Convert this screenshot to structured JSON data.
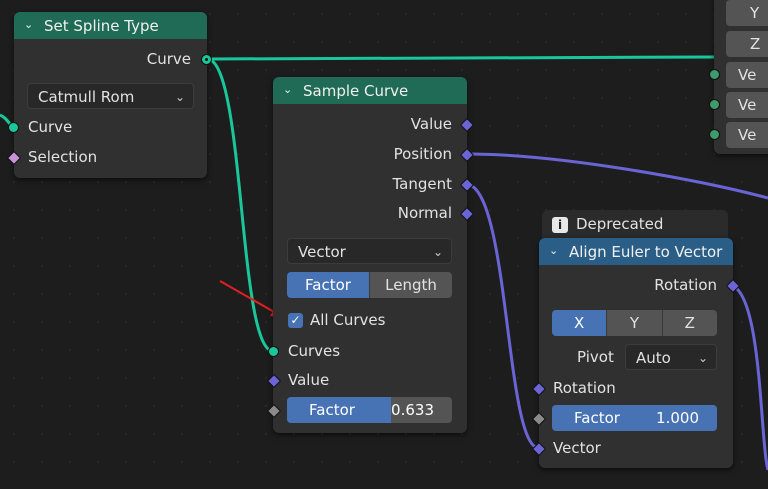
{
  "colors": {
    "wire_green": "#1ac79a",
    "wire_purple": "#6a64d4",
    "header_green": "#1f6b55",
    "header_blue": "#2a5e86",
    "accent": "#4772b3",
    "annotation_arrow": "#e02020"
  },
  "set_spline": {
    "title": "Set Spline Type",
    "output_curve": "Curve",
    "spline_type": "Catmull Rom",
    "input_curve": "Curve",
    "input_selection": "Selection"
  },
  "sample_curve": {
    "title": "Sample Curve",
    "outputs": {
      "value": "Value",
      "position": "Position",
      "tangent": "Tangent",
      "normal": "Normal"
    },
    "data_type": "Vector",
    "mode_factor": "Factor",
    "mode_length": "Length",
    "all_curves": "All Curves",
    "input_curves": "Curves",
    "input_value": "Value",
    "factor_label": "Factor",
    "factor_value": "0.633",
    "factor_fraction": 0.633
  },
  "align_euler": {
    "deprecated": "Deprecated",
    "title": "Align Euler to Vector",
    "output_rotation": "Rotation",
    "axis": [
      "X",
      "Y",
      "Z"
    ],
    "pivot_label": "Pivot",
    "pivot_value": "Auto",
    "input_rotation": "Rotation",
    "factor_label": "Factor",
    "factor_value": "1.000",
    "input_vector": "Vector"
  },
  "top_right_node": {
    "axis_y": "Y",
    "axis_z": "Z",
    "vec_label": "Ve"
  }
}
